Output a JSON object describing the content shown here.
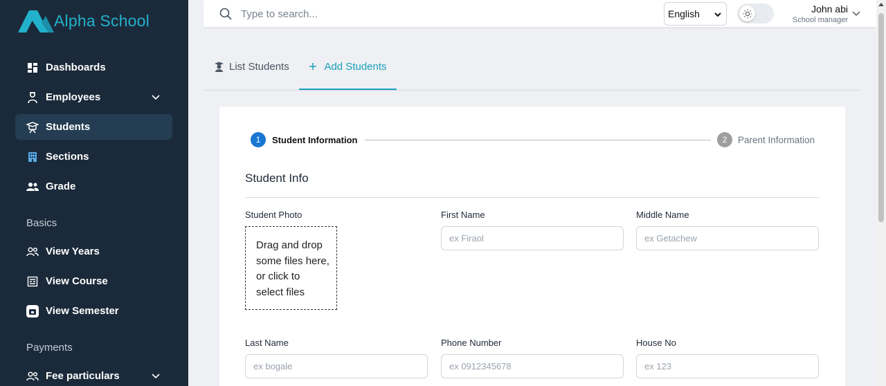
{
  "brand": {
    "name": "Alpha School",
    "color": "#22b1cc"
  },
  "sidebar": {
    "items": [
      {
        "label": "Dashboards",
        "icon": "dashboard-icon"
      },
      {
        "label": "Employees",
        "icon": "employee-icon",
        "expandable": true
      },
      {
        "label": "Students",
        "icon": "student-icon",
        "active": true
      },
      {
        "label": "Sections",
        "icon": "building-icon"
      },
      {
        "label": "Grade",
        "icon": "users-icon"
      }
    ],
    "basics_label": "Basics",
    "basics": [
      {
        "label": "View Years",
        "icon": "users-icon"
      },
      {
        "label": "View Course",
        "icon": "course-icon"
      },
      {
        "label": "View Semester",
        "icon": "semester-icon"
      }
    ],
    "payments_label": "Payments",
    "payments": [
      {
        "label": "Fee particulars",
        "icon": "users-icon",
        "expandable": true
      }
    ]
  },
  "topbar": {
    "search_placeholder": "Type to search...",
    "language": "English",
    "theme_toggle": "light",
    "user_name": "John abi",
    "user_role": "School manager"
  },
  "tabs": [
    {
      "label": "List Students",
      "icon": "graduate-icon",
      "active": false
    },
    {
      "label": "Add Students",
      "icon": "plus-icon",
      "active": true
    }
  ],
  "stepper": {
    "step1": {
      "number": "1",
      "label": "Student Information",
      "active": true
    },
    "step2": {
      "number": "2",
      "label": "Parent Information",
      "active": false
    }
  },
  "form": {
    "section_title": "Student Info",
    "photo_label": "Student Photo",
    "dropzone_text": "Drag and drop some files here, or click to select files",
    "fields": {
      "first_name": {
        "label": "First Name",
        "placeholder": "ex Firaol"
      },
      "middle_name": {
        "label": "Middle Name",
        "placeholder": "ex Getachew"
      },
      "last_name": {
        "label": "Last Name",
        "placeholder": "ex bogale"
      },
      "phone": {
        "label": "Phone Number",
        "placeholder": "ex 0912345678"
      },
      "house_no": {
        "label": "House No",
        "placeholder": "ex 123"
      }
    }
  },
  "colors": {
    "sidebar_bg": "#1b2a3a",
    "accent": "#1aa0bd",
    "step_active": "#1976d2"
  }
}
